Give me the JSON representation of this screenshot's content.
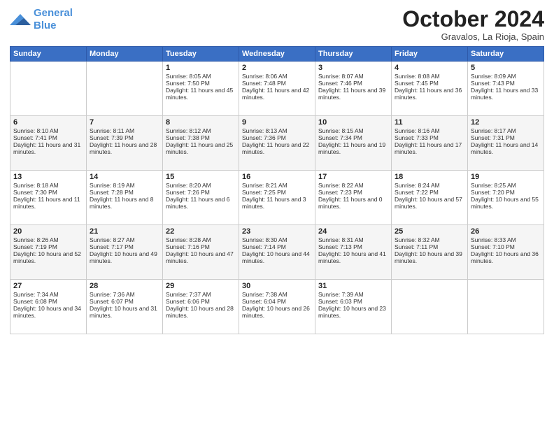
{
  "logo": {
    "line1": "General",
    "line2": "Blue"
  },
  "title": "October 2024",
  "location": "Gravalos, La Rioja, Spain",
  "weekdays": [
    "Sunday",
    "Monday",
    "Tuesday",
    "Wednesday",
    "Thursday",
    "Friday",
    "Saturday"
  ],
  "weeks": [
    [
      {
        "day": "",
        "sunrise": "",
        "sunset": "",
        "daylight": ""
      },
      {
        "day": "",
        "sunrise": "",
        "sunset": "",
        "daylight": ""
      },
      {
        "day": "1",
        "sunrise": "Sunrise: 8:05 AM",
        "sunset": "Sunset: 7:50 PM",
        "daylight": "Daylight: 11 hours and 45 minutes."
      },
      {
        "day": "2",
        "sunrise": "Sunrise: 8:06 AM",
        "sunset": "Sunset: 7:48 PM",
        "daylight": "Daylight: 11 hours and 42 minutes."
      },
      {
        "day": "3",
        "sunrise": "Sunrise: 8:07 AM",
        "sunset": "Sunset: 7:46 PM",
        "daylight": "Daylight: 11 hours and 39 minutes."
      },
      {
        "day": "4",
        "sunrise": "Sunrise: 8:08 AM",
        "sunset": "Sunset: 7:45 PM",
        "daylight": "Daylight: 11 hours and 36 minutes."
      },
      {
        "day": "5",
        "sunrise": "Sunrise: 8:09 AM",
        "sunset": "Sunset: 7:43 PM",
        "daylight": "Daylight: 11 hours and 33 minutes."
      }
    ],
    [
      {
        "day": "6",
        "sunrise": "Sunrise: 8:10 AM",
        "sunset": "Sunset: 7:41 PM",
        "daylight": "Daylight: 11 hours and 31 minutes."
      },
      {
        "day": "7",
        "sunrise": "Sunrise: 8:11 AM",
        "sunset": "Sunset: 7:39 PM",
        "daylight": "Daylight: 11 hours and 28 minutes."
      },
      {
        "day": "8",
        "sunrise": "Sunrise: 8:12 AM",
        "sunset": "Sunset: 7:38 PM",
        "daylight": "Daylight: 11 hours and 25 minutes."
      },
      {
        "day": "9",
        "sunrise": "Sunrise: 8:13 AM",
        "sunset": "Sunset: 7:36 PM",
        "daylight": "Daylight: 11 hours and 22 minutes."
      },
      {
        "day": "10",
        "sunrise": "Sunrise: 8:15 AM",
        "sunset": "Sunset: 7:34 PM",
        "daylight": "Daylight: 11 hours and 19 minutes."
      },
      {
        "day": "11",
        "sunrise": "Sunrise: 8:16 AM",
        "sunset": "Sunset: 7:33 PM",
        "daylight": "Daylight: 11 hours and 17 minutes."
      },
      {
        "day": "12",
        "sunrise": "Sunrise: 8:17 AM",
        "sunset": "Sunset: 7:31 PM",
        "daylight": "Daylight: 11 hours and 14 minutes."
      }
    ],
    [
      {
        "day": "13",
        "sunrise": "Sunrise: 8:18 AM",
        "sunset": "Sunset: 7:30 PM",
        "daylight": "Daylight: 11 hours and 11 minutes."
      },
      {
        "day": "14",
        "sunrise": "Sunrise: 8:19 AM",
        "sunset": "Sunset: 7:28 PM",
        "daylight": "Daylight: 11 hours and 8 minutes."
      },
      {
        "day": "15",
        "sunrise": "Sunrise: 8:20 AM",
        "sunset": "Sunset: 7:26 PM",
        "daylight": "Daylight: 11 hours and 6 minutes."
      },
      {
        "day": "16",
        "sunrise": "Sunrise: 8:21 AM",
        "sunset": "Sunset: 7:25 PM",
        "daylight": "Daylight: 11 hours and 3 minutes."
      },
      {
        "day": "17",
        "sunrise": "Sunrise: 8:22 AM",
        "sunset": "Sunset: 7:23 PM",
        "daylight": "Daylight: 11 hours and 0 minutes."
      },
      {
        "day": "18",
        "sunrise": "Sunrise: 8:24 AM",
        "sunset": "Sunset: 7:22 PM",
        "daylight": "Daylight: 10 hours and 57 minutes."
      },
      {
        "day": "19",
        "sunrise": "Sunrise: 8:25 AM",
        "sunset": "Sunset: 7:20 PM",
        "daylight": "Daylight: 10 hours and 55 minutes."
      }
    ],
    [
      {
        "day": "20",
        "sunrise": "Sunrise: 8:26 AM",
        "sunset": "Sunset: 7:19 PM",
        "daylight": "Daylight: 10 hours and 52 minutes."
      },
      {
        "day": "21",
        "sunrise": "Sunrise: 8:27 AM",
        "sunset": "Sunset: 7:17 PM",
        "daylight": "Daylight: 10 hours and 49 minutes."
      },
      {
        "day": "22",
        "sunrise": "Sunrise: 8:28 AM",
        "sunset": "Sunset: 7:16 PM",
        "daylight": "Daylight: 10 hours and 47 minutes."
      },
      {
        "day": "23",
        "sunrise": "Sunrise: 8:30 AM",
        "sunset": "Sunset: 7:14 PM",
        "daylight": "Daylight: 10 hours and 44 minutes."
      },
      {
        "day": "24",
        "sunrise": "Sunrise: 8:31 AM",
        "sunset": "Sunset: 7:13 PM",
        "daylight": "Daylight: 10 hours and 41 minutes."
      },
      {
        "day": "25",
        "sunrise": "Sunrise: 8:32 AM",
        "sunset": "Sunset: 7:11 PM",
        "daylight": "Daylight: 10 hours and 39 minutes."
      },
      {
        "day": "26",
        "sunrise": "Sunrise: 8:33 AM",
        "sunset": "Sunset: 7:10 PM",
        "daylight": "Daylight: 10 hours and 36 minutes."
      }
    ],
    [
      {
        "day": "27",
        "sunrise": "Sunrise: 7:34 AM",
        "sunset": "Sunset: 6:08 PM",
        "daylight": "Daylight: 10 hours and 34 minutes."
      },
      {
        "day": "28",
        "sunrise": "Sunrise: 7:36 AM",
        "sunset": "Sunset: 6:07 PM",
        "daylight": "Daylight: 10 hours and 31 minutes."
      },
      {
        "day": "29",
        "sunrise": "Sunrise: 7:37 AM",
        "sunset": "Sunset: 6:06 PM",
        "daylight": "Daylight: 10 hours and 28 minutes."
      },
      {
        "day": "30",
        "sunrise": "Sunrise: 7:38 AM",
        "sunset": "Sunset: 6:04 PM",
        "daylight": "Daylight: 10 hours and 26 minutes."
      },
      {
        "day": "31",
        "sunrise": "Sunrise: 7:39 AM",
        "sunset": "Sunset: 6:03 PM",
        "daylight": "Daylight: 10 hours and 23 minutes."
      },
      {
        "day": "",
        "sunrise": "",
        "sunset": "",
        "daylight": ""
      },
      {
        "day": "",
        "sunrise": "",
        "sunset": "",
        "daylight": ""
      }
    ]
  ]
}
